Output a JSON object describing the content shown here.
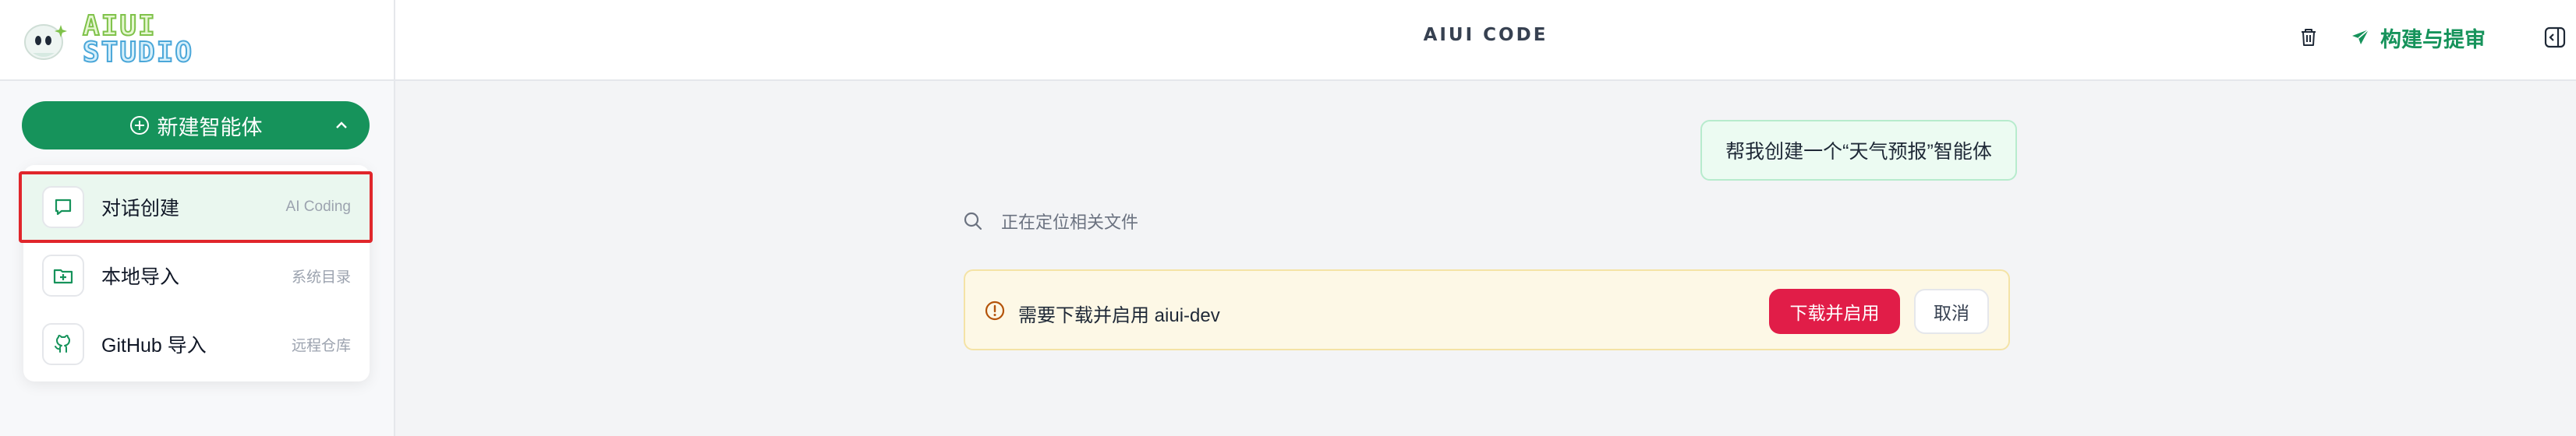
{
  "brand": {
    "line1": "AIUI",
    "line2": "STUDIO",
    "colors": {
      "line1": "#7fc24a",
      "line2": "#4ba7d9"
    }
  },
  "sidebar": {
    "new_agent_label": "新建智能体",
    "menu_items": [
      {
        "label": "对话创建",
        "hint": "AI Coding",
        "icon": "chat-icon",
        "active": true
      },
      {
        "label": "本地导入",
        "hint": "系统目录",
        "icon": "folder-import-icon",
        "active": false
      },
      {
        "label": "GitHub 导入",
        "hint": "远程仓库",
        "icon": "github-icon",
        "active": false
      }
    ]
  },
  "header": {
    "title": "AIUI CODE",
    "build_label": "构建与提审",
    "icons": [
      "trash-icon",
      "send-icon",
      "panel-toggle-icon"
    ]
  },
  "chat": {
    "user_message": "帮我创建一个“天气预报”智能体",
    "status_text": "正在定位相关文件",
    "install_prompt": {
      "message": "需要下载并启用 aiui-dev",
      "confirm_label": "下载并启用",
      "cancel_label": "取消"
    }
  },
  "colors": {
    "primary": "#16935b",
    "danger": "#e11d48",
    "highlight_border": "#e0262b",
    "warning_bg": "#fdf8e6"
  }
}
